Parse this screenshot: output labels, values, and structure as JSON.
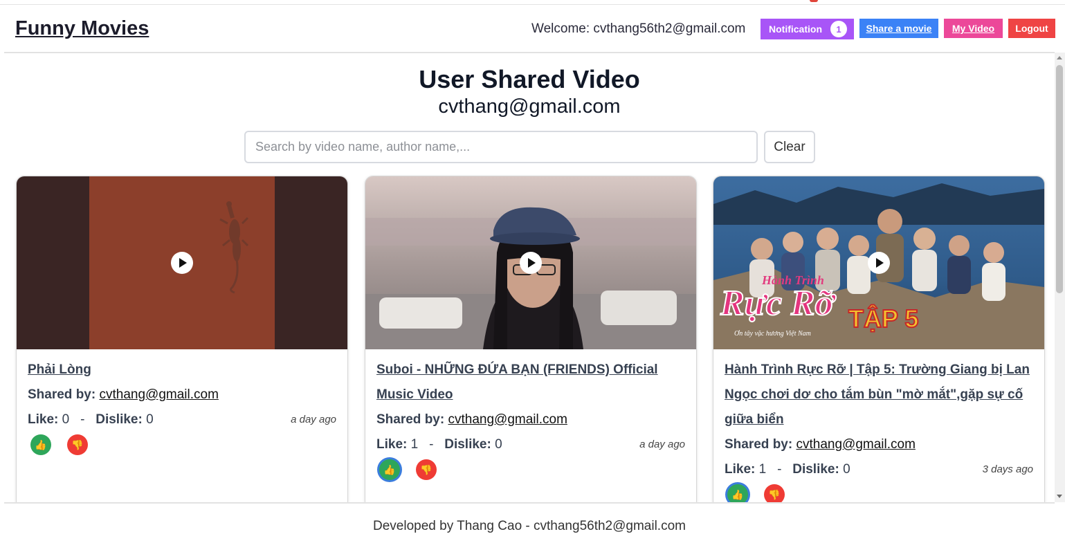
{
  "header": {
    "brand": "Funny Movies",
    "welcome_label": "Welcome:",
    "welcome_email": "cvthang56th2@gmail.com",
    "notification_label": "Notification",
    "notification_count": "1",
    "share_label": "Share a movie",
    "my_video_label": "My Video",
    "logout_label": "Logout"
  },
  "page": {
    "title": "User Shared Video",
    "user_email": "cvthang@gmail.com"
  },
  "search": {
    "placeholder": "Search by video name, author name,...",
    "value": "",
    "clear_label": "Clear"
  },
  "labels": {
    "shared_by": "Shared by:",
    "like": "Like:",
    "dislike": "Dislike:",
    "separator": "-"
  },
  "videos": [
    {
      "title": "Phải Lòng",
      "shared_by": "cvthang@gmail.com",
      "likes": "0",
      "dislikes": "0",
      "time": "a day ago",
      "liked": false
    },
    {
      "title": "Suboi - NHỮNG ĐỨA BẠN (FRIENDS) Official Music Video",
      "shared_by": "cvthang@gmail.com",
      "likes": "1",
      "dislikes": "0",
      "time": "a day ago",
      "liked": true
    },
    {
      "title": "Hành Trình Rực Rỡ | Tập 5: Trường Giang bị Lan Ngọc chơi dơ cho tắm bùn \"mờ mắt\",gặp sự cố giữa biển",
      "shared_by": "cvthang@gmail.com",
      "likes": "1",
      "dislikes": "0",
      "time": "3 days ago",
      "liked": true
    }
  ],
  "thumbnail_overlay_text": {
    "logo_small": "Hành Trình",
    "logo_big": "Rực Rỡ",
    "episode": "TẬP 5",
    "tagline": "Ơn tây vặc hương Việt Nam"
  },
  "footer": {
    "text": "Developed by Thang Cao - cvthang56th2@gmail.com"
  },
  "colors": {
    "notification": "#a855f7",
    "share": "#3b82f6",
    "my_video": "#ec4899",
    "logout": "#ef4444",
    "like": "#2ea65a",
    "dislike": "#ef3b34"
  }
}
